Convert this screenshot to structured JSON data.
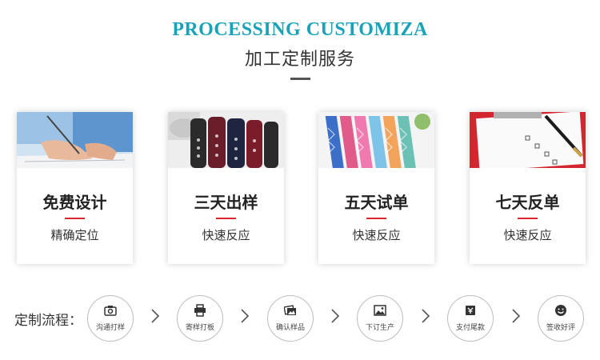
{
  "header": {
    "title_en": "PROCESSING CUSTOMIZA",
    "title_cn": "加工定制服务"
  },
  "cards": [
    {
      "title": "免费设计",
      "subtitle": "精确定位",
      "image_icon": "hand-writing-photo"
    },
    {
      "title": "三天出样",
      "subtitle": "快速反应",
      "image_icon": "lace-ribbon-rolls-photo"
    },
    {
      "title": "五天试单",
      "subtitle": "快速反应",
      "image_icon": "colorful-ribbon-photo"
    },
    {
      "title": "七天反单",
      "subtitle": "快速反应",
      "image_icon": "pen-checklist-photo"
    }
  ],
  "flow": {
    "label": "定制流程：",
    "steps": [
      {
        "label": "沟通打样",
        "icon": "camera-icon"
      },
      {
        "label": "寄样打板",
        "icon": "printer-icon"
      },
      {
        "label": "确认样品",
        "icon": "photos-icon"
      },
      {
        "label": "下订生产",
        "icon": "picture-icon"
      },
      {
        "label": "支付尾款",
        "icon": "payment-icon"
      },
      {
        "label": "签收好评",
        "icon": "smiley-icon"
      }
    ]
  },
  "colors": {
    "title_accent": "#1aa3b8",
    "red_divider": "#d8262f"
  }
}
